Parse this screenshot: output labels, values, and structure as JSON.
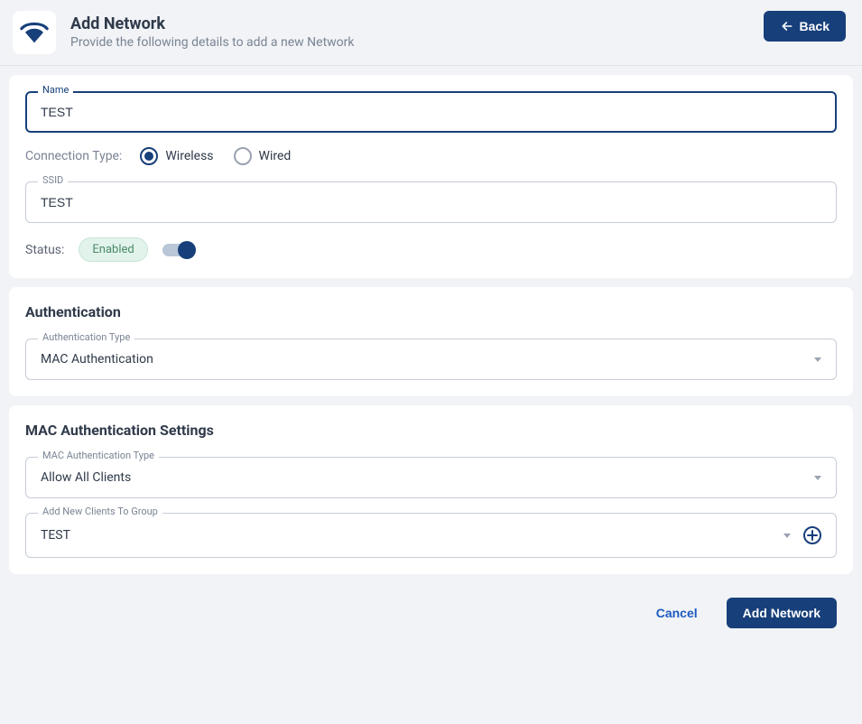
{
  "header": {
    "title": "Add Network",
    "subtitle": "Provide the following details to add a new Network",
    "back_label": "Back"
  },
  "form": {
    "name_label": "Name",
    "name_value": "TEST",
    "conn_type_label": "Connection Type:",
    "conn_options": {
      "wireless": "Wireless",
      "wired": "Wired"
    },
    "ssid_label": "SSID",
    "ssid_value": "TEST",
    "status_label": "Status:",
    "status_badge": "Enabled"
  },
  "auth": {
    "section_title": "Authentication",
    "type_label": "Authentication Type",
    "type_value": "MAC Authentication"
  },
  "mac": {
    "section_title": "MAC Authentication Settings",
    "type_label": "MAC Authentication Type",
    "type_value": "Allow All Clients",
    "group_label": "Add New Clients To Group",
    "group_value": "TEST"
  },
  "footer": {
    "cancel_label": "Cancel",
    "submit_label": "Add Network"
  }
}
